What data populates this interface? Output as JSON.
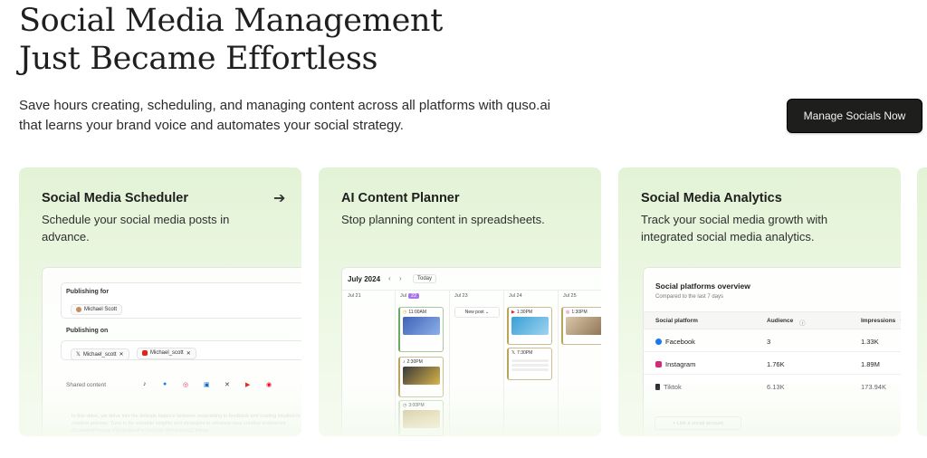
{
  "hero": {
    "title_line1": "Social Media Management",
    "title_line2": "Just Became Effortless",
    "subtitle_line1": "Save hours creating, scheduling, and managing content across all platforms with quso.ai",
    "subtitle_line2": "that learns your brand voice and automates your social strategy.",
    "cta_label": "Manage Socials Now"
  },
  "cards": [
    {
      "title": "Social Media Scheduler",
      "description": "Schedule your social media posts in advance.",
      "arrow": "➔"
    },
    {
      "title": "AI Content Planner",
      "description": "Stop planning content in spreadsheets."
    },
    {
      "title": "Social Media Analytics",
      "description": "Track your social media growth with integrated social media analytics."
    }
  ],
  "scheduler": {
    "publishing_for_label": "Publishing for",
    "account": "Michael Scott",
    "publishing_on_label": "Publishing on",
    "accounts_on": [
      "Michael_scott",
      "Michael_scott"
    ],
    "remove_glyph": "✕",
    "shared_label": "Shared content",
    "faded_text": "In this video, we delve into the delicate balance between responding to feedback and trusting intuition in the creative process. Tune in for valuable insights and strategies to enhance your creative endeavors. #CreativeProcess #StrategiesForSuccess #EmbracingChange",
    "platform_glyphs": [
      "♪",
      "●",
      "◎",
      "▣",
      "✕",
      "▶",
      "◉"
    ]
  },
  "planner": {
    "month": "July 2024",
    "nav_prev": "‹",
    "nav_next": "›",
    "today_label": "Today",
    "days": [
      "Jul 21",
      "Jul",
      "22",
      "Jul 23",
      "Jul 24",
      "Jul 25"
    ],
    "new_post_label": "New post  ⌄",
    "times": [
      "11:00AM",
      "2:30PM",
      "3:00PM",
      "1:30PM",
      "7:30PM",
      "1:30PM"
    ]
  },
  "analytics": {
    "title": "Social platforms overview",
    "subtitle": "Compared to the last 7 days",
    "headers": [
      "Social platform",
      "Audience",
      "Impressions"
    ],
    "info_glyph": "ⓘ",
    "sort_glyph": "⇅",
    "rows": [
      {
        "platform": "Facebook",
        "audience": "3",
        "impressions": "1.33K",
        "color": "#1877f2"
      },
      {
        "platform": "Instagram",
        "audience": "1.76K",
        "impressions": "1.89M",
        "color": "#d62976"
      },
      {
        "platform": "Tiktok",
        "audience": "6.13K",
        "impressions": "173.94K",
        "color": "#222222"
      }
    ],
    "link_label": "+ Link a social account"
  }
}
